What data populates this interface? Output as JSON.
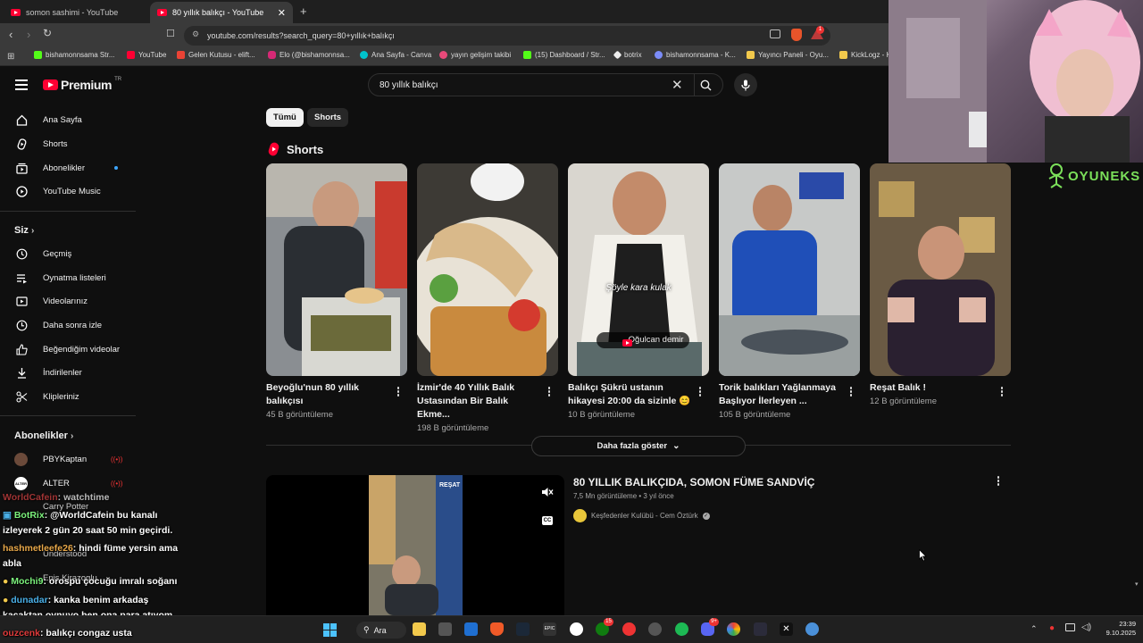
{
  "browser": {
    "tabs": [
      {
        "title": "somon sashimi - YouTube"
      },
      {
        "title": "80 yıllık balıkçı - YouTube"
      }
    ],
    "url": "youtube.com/results?search_query=80+yıllık+balıkçı",
    "bookmarks": [
      "bishamonnsama Str...",
      "YouTube",
      "Gelen Kutusu - elift...",
      "Elo (@bishamonnsa...",
      "Ana Sayfa - Canva",
      "yayın gelişim takibi",
      "(15) Dashboard / Str...",
      "botrix",
      "bishamonnsama - K...",
      "Yayıncı Paneli - Oyu...",
      "KickLogz - K"
    ],
    "ext_badge": "1"
  },
  "header": {
    "logo": "Premium",
    "logo_sup": "TR",
    "search_value": "80 yıllık balıkçı"
  },
  "sidebar": {
    "main": [
      "Ana Sayfa",
      "Shorts",
      "Abonelikler",
      "YouTube Music"
    ],
    "you_title": "Siz",
    "you_items": [
      "Geçmiş",
      "Oynatma listeleri",
      "Videolarınız",
      "Daha sonra izle",
      "Beğendiğim videolar",
      "İndirilenler",
      "Klipleriniz"
    ],
    "subs_title": "Abonelikler",
    "subs": [
      "PBYKaptan",
      "ALTER",
      "Carry Potter",
      "Understood",
      "Enis Kirazoglu"
    ]
  },
  "chips": [
    "Tümü",
    "Shorts"
  ],
  "shorts_section": {
    "title": "Shorts",
    "items": [
      {
        "title": "Beyoğlu'nun 80 yıllık balıkçısı",
        "views": "45 B görüntüleme"
      },
      {
        "title": "İzmir'de 40 Yıllık Balık Ustasından Bir Balık Ekme...",
        "views": "198 B görüntüleme"
      },
      {
        "title": "Balıkçı Şükrü ustanın hikayesi 20:00 da sizinle 😊",
        "views": "10 B görüntüleme",
        "overlay_text": "Şöyle kara kulak",
        "channel_tag": "Oğulcan demir"
      },
      {
        "title": "Torik balıkları Yağlanmaya Başlıyor İlerleyen ...",
        "views": "105 B görüntüleme"
      },
      {
        "title": "Reşat Balık !",
        "views": "12 B görüntüleme"
      }
    ],
    "more_button": "Daha fazla göster"
  },
  "video_result": {
    "title": "80 YILLIK BALIKÇIDA, SOMON FÜME SANDVİÇ",
    "meta": "7,5 Mn görüntüleme • 3 yıl önce",
    "channel": "Keşfedenler Kulübü - Cem Öztürk",
    "sign_text": "REŞAT"
  },
  "overlay": {
    "brand": "OYUNEKS",
    "chat": [
      {
        "user": "WorldCafein",
        "text": ": watchtime",
        "color": "#d44"
      },
      {
        "user": "BotRix",
        "text": ": @WorldCafein bu kanalı",
        "color": "#7cf27c"
      },
      {
        "user": "",
        "text": "izleyerek 2 gün 20 saat 50 min geçirdi.",
        "color": "#fff"
      },
      {
        "user": "hashmetleefe26",
        "text": ": hindi füme yersin ama",
        "color": "#e8a84a"
      },
      {
        "user": "",
        "text": "abla",
        "color": "#fff"
      },
      {
        "user": "Mochi9",
        "text": ": orospu çocuğu imralı soğanı",
        "color": "#7cf27c"
      },
      {
        "user": "dunadar",
        "text": ": kanka benim arkadaş",
        "color": "#4ab0e8"
      },
      {
        "user": "",
        "text": "kaçaktan oynuyo ben ona para atıyom",
        "color": "#fff"
      },
      {
        "user": "ouzcenk",
        "text": ": balıkçı congaz usta",
        "color": "#e03b3b"
      }
    ]
  },
  "taskbar": {
    "search": "Ara",
    "time": "23:39",
    "date": "9.10.2025",
    "badges": [
      "15",
      "9+"
    ]
  }
}
